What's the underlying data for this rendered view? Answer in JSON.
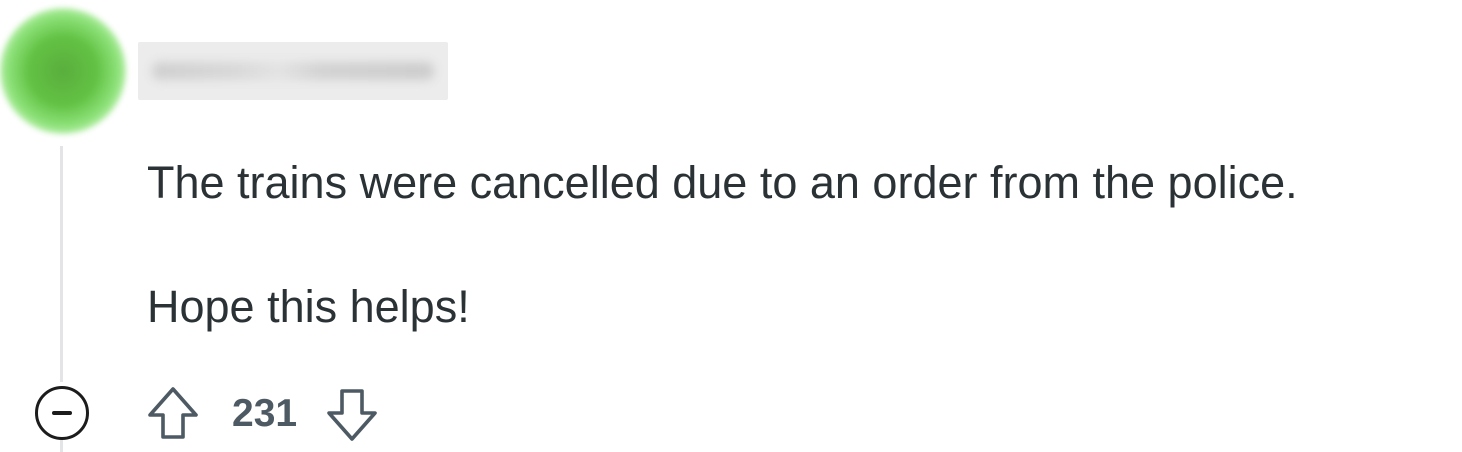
{
  "comment": {
    "paragraphs": [
      "The trains were cancelled due to an order from the police.",
      "Hope this helps!"
    ],
    "score": "231"
  },
  "icons": {
    "avatar": "avatar-image",
    "collapse": "collapse-minus-circle-icon",
    "upvote": "arrow-up-outline-icon",
    "downvote": "arrow-down-outline-icon"
  },
  "colors": {
    "text": "#2a3236",
    "score": "#4e5a63",
    "thread_line": "#e2e4e6",
    "avatar_green": "#62c244"
  }
}
